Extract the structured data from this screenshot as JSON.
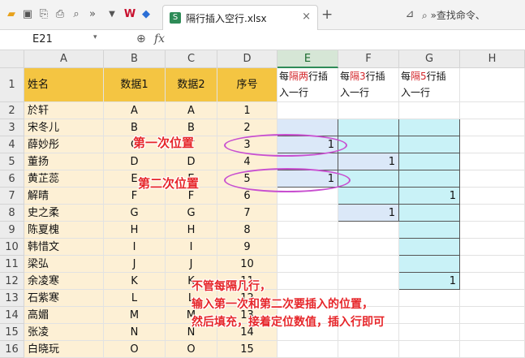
{
  "toolbar": {
    "tab_title": "隔行插入空行.xlsx",
    "close_glyph": "×",
    "new_tab_glyph": "+",
    "search_placeholder": "»查找命令、",
    "file_badge": "S"
  },
  "formula_bar": {
    "cell_ref": "E21",
    "fx": "fx"
  },
  "columns": [
    "A",
    "B",
    "C",
    "D",
    "E",
    "F",
    "G",
    "H"
  ],
  "rows": [
    {
      "n": "1",
      "a": "姓名",
      "b": "数据1",
      "c": "数据2",
      "d": "序号"
    },
    {
      "n": "2",
      "a": "於轩",
      "b": "A",
      "c": "A",
      "d": "1"
    },
    {
      "n": "3",
      "a": "宋冬儿",
      "b": "B",
      "c": "B",
      "d": "2"
    },
    {
      "n": "4",
      "a": "薛妙彤",
      "b": "C",
      "c": "C",
      "d": "3"
    },
    {
      "n": "5",
      "a": "董扬",
      "b": "D",
      "c": "D",
      "d": "4"
    },
    {
      "n": "6",
      "a": "黄芷蕊",
      "b": "E",
      "c": "E",
      "d": "5"
    },
    {
      "n": "7",
      "a": "解晴",
      "b": "F",
      "c": "F",
      "d": "6"
    },
    {
      "n": "8",
      "a": "史之柔",
      "b": "G",
      "c": "G",
      "d": "7"
    },
    {
      "n": "9",
      "a": "陈夏槐",
      "b": "H",
      "c": "H",
      "d": "8"
    },
    {
      "n": "10",
      "a": "韩惜文",
      "b": "I",
      "c": "I",
      "d": "9"
    },
    {
      "n": "11",
      "a": "梁弘",
      "b": "J",
      "c": "J",
      "d": "10"
    },
    {
      "n": "12",
      "a": "余凌寒",
      "b": "K",
      "c": "K",
      "d": "11"
    },
    {
      "n": "13",
      "a": "石紫寒",
      "b": "L",
      "c": "L",
      "d": "12"
    },
    {
      "n": "14",
      "a": "高媚",
      "b": "M",
      "c": "M",
      "d": "13"
    },
    {
      "n": "15",
      "a": "张凌",
      "b": "N",
      "c": "N",
      "d": "14"
    },
    {
      "n": "16",
      "a": "白晓玩",
      "b": "O",
      "c": "O",
      "d": "15"
    }
  ],
  "headers_efg": {
    "e": {
      "p1": "每",
      "p2": "隔两",
      "p3": "行插",
      "line2": "入一行"
    },
    "f": {
      "p1": "每",
      "p2": "隔3",
      "p3": "行插",
      "line2": "入一行"
    },
    "g": {
      "p1": "每",
      "p2": "隔5",
      "p3": "行插",
      "line2": "入一行"
    }
  },
  "values": {
    "e4": "1",
    "e6": "1",
    "f5": "1",
    "f8": "1",
    "g7": "1",
    "g12": "1"
  },
  "annotations": {
    "first": "第一次位置",
    "second": "第二次位置",
    "note_line1": "不管每隔几行，",
    "note_line2": "输入第一次和第二次要插入的位置，",
    "note_line3": "然后填充，接着定位数值，插入行即可"
  },
  "colors": {
    "header_fill": "#f4c542",
    "name_fill": "#fdf0d5",
    "cyan": "#c9f2f7",
    "light_blue": "#dbe8f8",
    "annotation": "#e6262a",
    "ellipse": "#c84fd0"
  }
}
